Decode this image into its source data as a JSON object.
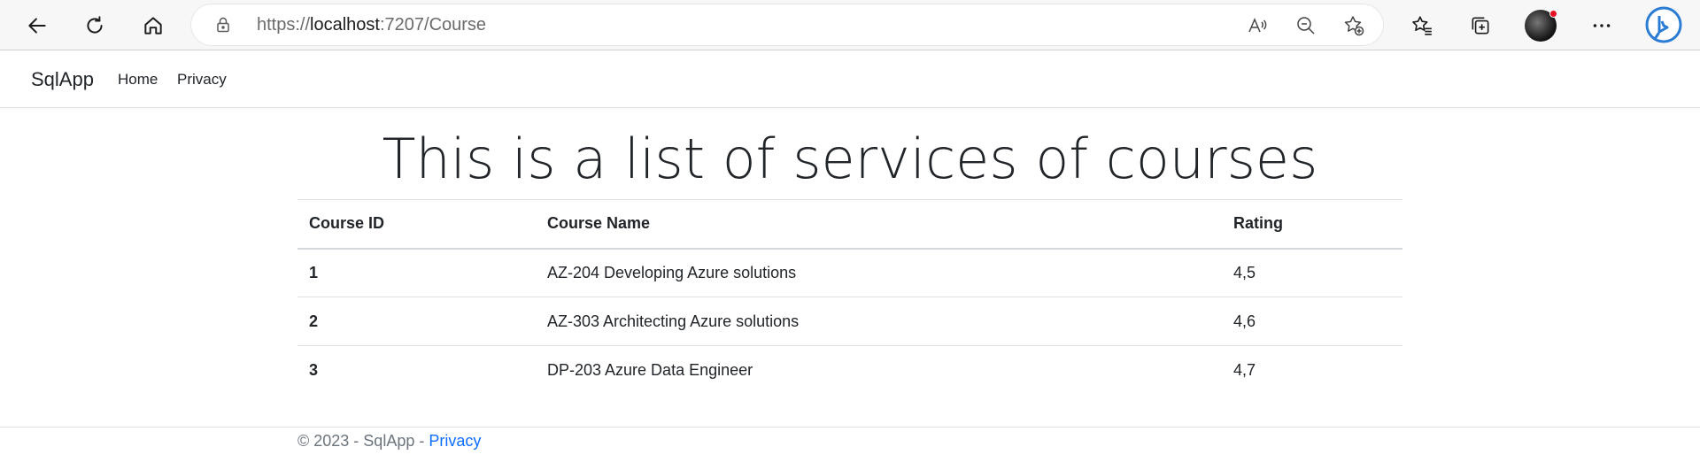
{
  "browser": {
    "url_scheme": "https://",
    "url_host": "localhost",
    "url_rest": ":7207/Course",
    "icons": [
      "back-icon",
      "refresh-icon",
      "home-icon",
      "lock-icon",
      "read-aloud-icon",
      "zoom-out-icon",
      "add-favorite-icon",
      "favorites-icon",
      "collections-icon",
      "profile-avatar",
      "more-icon",
      "bing-icon"
    ]
  },
  "nav": {
    "brand": "SqlApp",
    "links": [
      "Home",
      "Privacy"
    ]
  },
  "main": {
    "title": "This is a list of services of courses",
    "table": {
      "headers": [
        "Course ID",
        "Course Name",
        "Rating"
      ],
      "rows": [
        {
          "id": "1",
          "name": "AZ-204 Developing Azure solutions",
          "rating": "4,5"
        },
        {
          "id": "2",
          "name": "AZ-303 Architecting Azure solutions",
          "rating": "4,6"
        },
        {
          "id": "3",
          "name": "DP-203 Azure Data Engineer",
          "rating": "4,7"
        }
      ]
    }
  },
  "footer": {
    "text": "© 2023 - SqlApp - ",
    "link": "Privacy"
  },
  "colors": {
    "link": "#0d6efd",
    "muted": "#6c757d",
    "border": "#dee2e6",
    "notification": "#e81123"
  }
}
